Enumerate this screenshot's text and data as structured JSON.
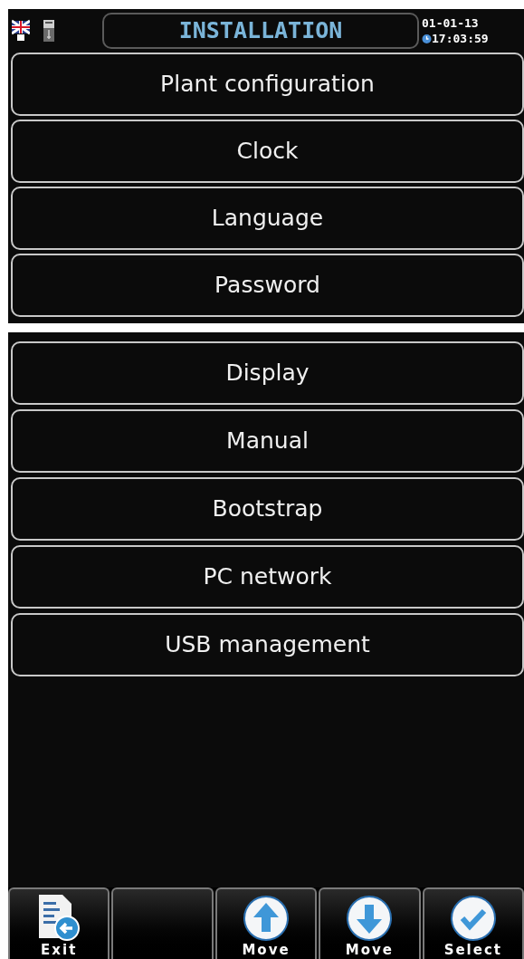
{
  "header": {
    "title": "INSTALLATION",
    "date": "01-01-13",
    "time": "17:03:59"
  },
  "menu_upper": [
    "Plant configuration",
    "Clock",
    "Language",
    "Password"
  ],
  "menu_lower": [
    "Display",
    "Manual",
    "Bootstrap",
    "PC network",
    "USB management"
  ],
  "softkeys": [
    {
      "kind": "exit",
      "label": "Exit"
    },
    {
      "kind": "blank"
    },
    {
      "kind": "up",
      "label": "Move"
    },
    {
      "kind": "down",
      "label": "Move"
    },
    {
      "kind": "select",
      "label": "Select"
    }
  ]
}
